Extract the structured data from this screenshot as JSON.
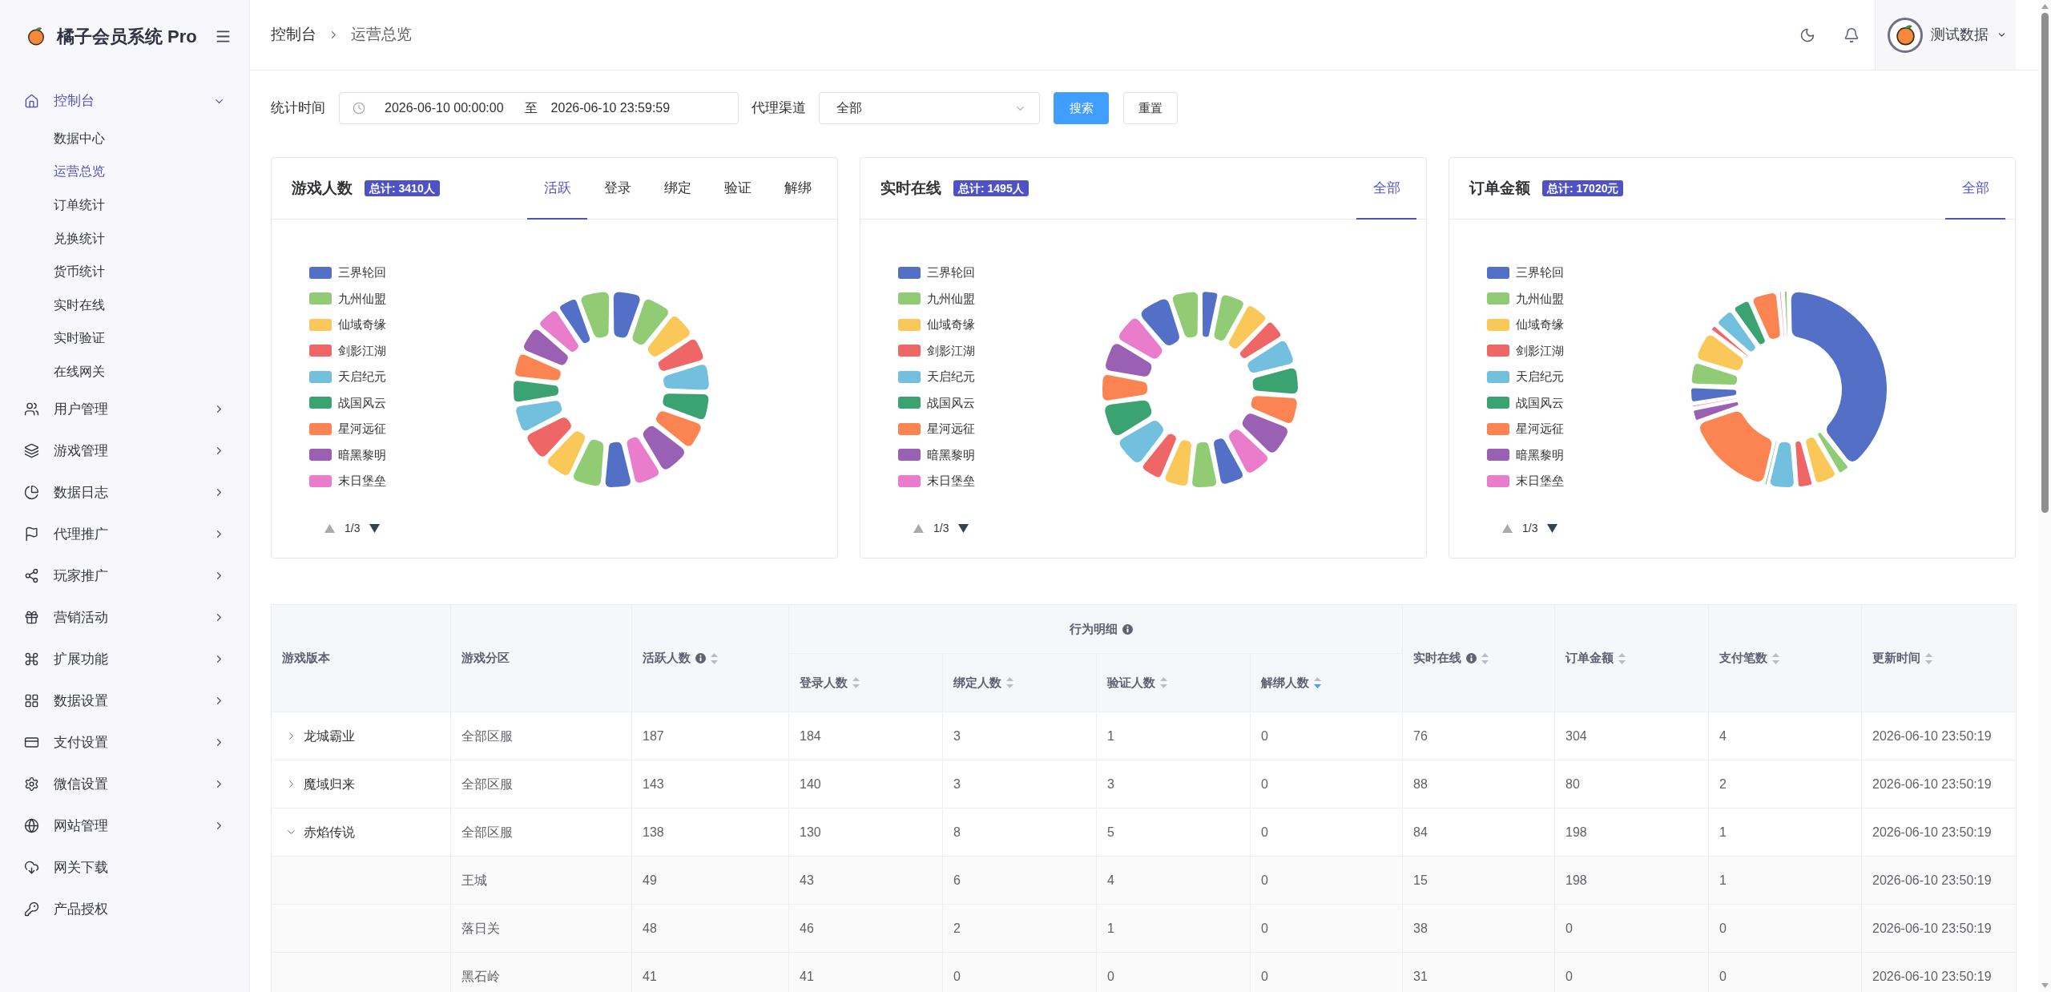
{
  "sidebar": {
    "brand": "橘子会员系统 Pro",
    "items": [
      {
        "label": "控制台",
        "kind": "group",
        "selected": true,
        "expanded": true,
        "children": [
          {
            "label": "数据中心",
            "selected": false
          },
          {
            "label": "运营总览",
            "selected": true
          },
          {
            "label": "订单统计",
            "selected": false
          },
          {
            "label": "兑换统计",
            "selected": false
          },
          {
            "label": "货币统计",
            "selected": false
          },
          {
            "label": "实时在线",
            "selected": false
          },
          {
            "label": "实时验证",
            "selected": false
          },
          {
            "label": "在线网关",
            "selected": false
          }
        ]
      },
      {
        "label": "用户管理",
        "kind": "group",
        "selected": false,
        "expanded": false
      },
      {
        "label": "游戏管理",
        "kind": "group",
        "selected": false,
        "expanded": false
      },
      {
        "label": "数据日志",
        "kind": "group",
        "selected": false,
        "expanded": false
      },
      {
        "label": "代理推广",
        "kind": "group",
        "selected": false,
        "expanded": false
      },
      {
        "label": "玩家推广",
        "kind": "group",
        "selected": false,
        "expanded": false
      },
      {
        "label": "营销活动",
        "kind": "group",
        "selected": false,
        "expanded": false
      },
      {
        "label": "扩展功能",
        "kind": "group",
        "selected": false,
        "expanded": false
      },
      {
        "label": "数据设置",
        "kind": "group",
        "selected": false,
        "expanded": false
      },
      {
        "label": "支付设置",
        "kind": "group",
        "selected": false,
        "expanded": false
      },
      {
        "label": "微信设置",
        "kind": "group",
        "selected": false,
        "expanded": false
      },
      {
        "label": "网站管理",
        "kind": "group",
        "selected": false,
        "expanded": false
      },
      {
        "label": "网关下载",
        "kind": "link",
        "selected": false
      },
      {
        "label": "产品授权",
        "kind": "link",
        "selected": false
      }
    ]
  },
  "header": {
    "breadcrumb": [
      "控制台",
      "运营总览"
    ],
    "user": {
      "name": "测试数据"
    }
  },
  "filters": {
    "fields": [
      {
        "kind": "daterange",
        "label": "统计时间",
        "start": "2026-06-10 00:00:00",
        "separator": "至",
        "end": "2026-06-10 23:59:59"
      },
      {
        "kind": "select",
        "label": "代理渠道",
        "value": "全部"
      }
    ],
    "buttons": [
      {
        "label": "搜索",
        "kind": "primary"
      },
      {
        "label": "重置",
        "kind": "default"
      }
    ]
  },
  "cards": [
    {
      "title": "游戏人数",
      "total": "总计: 3410人",
      "tabs": [
        {
          "label": "活跃",
          "selected": true
        },
        {
          "label": "登录",
          "selected": false
        },
        {
          "label": "绑定",
          "selected": false
        },
        {
          "label": "验证",
          "selected": false
        },
        {
          "label": "解绑",
          "selected": false
        }
      ],
      "legend": [
        {
          "label": "三界轮回",
          "color": "#5470c6"
        },
        {
          "label": "九州仙盟",
          "color": "#91cc75"
        },
        {
          "label": "仙域奇缘",
          "color": "#fac858"
        },
        {
          "label": "剑影江湖",
          "color": "#ee6666"
        },
        {
          "label": "天启纪元",
          "color": "#73c0de"
        },
        {
          "label": "战国风云",
          "color": "#3ba272"
        },
        {
          "label": "星河远征",
          "color": "#fc8452"
        },
        {
          "label": "暗黑黎明",
          "color": "#9a60b4"
        },
        {
          "label": "末日堡垒",
          "color": "#ea7ccc"
        }
      ],
      "pager": {
        "page": "1/3",
        "prev_disabled": true,
        "next_disabled": false
      }
    },
    {
      "title": "实时在线",
      "total": "总计: 1495人",
      "tabs": [
        {
          "label": "全部",
          "selected": true
        }
      ],
      "legend": [
        {
          "label": "三界轮回",
          "color": "#5470c6"
        },
        {
          "label": "九州仙盟",
          "color": "#91cc75"
        },
        {
          "label": "仙域奇缘",
          "color": "#fac858"
        },
        {
          "label": "剑影江湖",
          "color": "#ee6666"
        },
        {
          "label": "天启纪元",
          "color": "#73c0de"
        },
        {
          "label": "战国风云",
          "color": "#3ba272"
        },
        {
          "label": "星河远征",
          "color": "#fc8452"
        },
        {
          "label": "暗黑黎明",
          "color": "#9a60b4"
        },
        {
          "label": "末日堡垒",
          "color": "#ea7ccc"
        }
      ],
      "pager": {
        "page": "1/3",
        "prev_disabled": true,
        "next_disabled": false
      }
    },
    {
      "title": "订单金额",
      "total": "总计: 17020元",
      "tabs": [
        {
          "label": "全部",
          "selected": true
        }
      ],
      "legend": [
        {
          "label": "三界轮回",
          "color": "#5470c6"
        },
        {
          "label": "九州仙盟",
          "color": "#91cc75"
        },
        {
          "label": "仙域奇缘",
          "color": "#fac858"
        },
        {
          "label": "剑影江湖",
          "color": "#ee6666"
        },
        {
          "label": "天启纪元",
          "color": "#73c0de"
        },
        {
          "label": "战国风云",
          "color": "#3ba272"
        },
        {
          "label": "星河远征",
          "color": "#fc8452"
        },
        {
          "label": "暗黑黎明",
          "color": "#9a60b4"
        },
        {
          "label": "末日堡垒",
          "color": "#ea7ccc"
        }
      ],
      "pager": {
        "page": "1/3",
        "prev_disabled": true,
        "next_disabled": false
      }
    }
  ],
  "table": {
    "columns": [
      {
        "label": "游戏版本",
        "tip": false,
        "sortable": false
      },
      {
        "label": "游戏分区",
        "tip": false,
        "sortable": false
      },
      {
        "label": "活跃人数",
        "tip": true,
        "sortable": true,
        "sorted_desc": false
      },
      {
        "label": "行为明细",
        "tip": true,
        "colspan": 4,
        "children": [
          {
            "label": "登录人数",
            "tip": false,
            "sortable": true,
            "sorted_desc": false
          },
          {
            "label": "绑定人数",
            "tip": false,
            "sortable": true,
            "sorted_desc": false
          },
          {
            "label": "验证人数",
            "tip": false,
            "sortable": true,
            "sorted_desc": false
          },
          {
            "label": "解绑人数",
            "tip": false,
            "sortable": true,
            "sorted_desc": true
          }
        ]
      },
      {
        "label": "实时在线",
        "tip": true,
        "sortable": true,
        "sorted_desc": false
      },
      {
        "label": "订单金额",
        "tip": false,
        "sortable": true,
        "sorted_desc": false
      },
      {
        "label": "支付笔数",
        "tip": false,
        "sortable": true,
        "sorted_desc": false
      },
      {
        "label": "更新时间",
        "tip": false,
        "sortable": true,
        "sorted_desc": false
      }
    ],
    "rows": [
      {
        "cells": [
          "龙城霸业",
          "全部区服",
          "187",
          "184",
          "3",
          "1",
          "0",
          "76",
          "304",
          "4",
          "2026-06-10 23:50:19"
        ],
        "expanded": false
      },
      {
        "cells": [
          "魔域归来",
          "全部区服",
          "143",
          "140",
          "3",
          "3",
          "0",
          "88",
          "80",
          "2",
          "2026-06-10 23:50:19"
        ],
        "expanded": false
      },
      {
        "cells": [
          "赤焰传说",
          "全部区服",
          "138",
          "130",
          "8",
          "5",
          "0",
          "84",
          "198",
          "1",
          "2026-06-10 23:50:19"
        ],
        "expanded": true,
        "children": [
          {
            "cells": [
              "",
              "王城",
              "49",
              "43",
              "6",
              "4",
              "0",
              "15",
              "198",
              "1",
              "2026-06-10 23:50:19"
            ]
          },
          {
            "cells": [
              "",
              "落日关",
              "48",
              "46",
              "2",
              "1",
              "0",
              "38",
              "0",
              "0",
              "2026-06-10 23:50:19"
            ]
          },
          {
            "cells": [
              "",
              "黑石岭",
              "41",
              "41",
              "0",
              "0",
              "0",
              "31",
              "0",
              "0",
              "2026-06-10 23:50:19"
            ]
          }
        ]
      }
    ]
  }
}
